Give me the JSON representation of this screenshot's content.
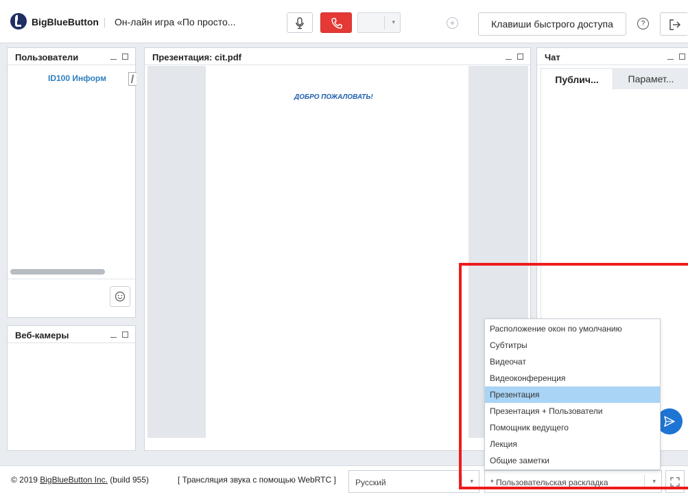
{
  "header": {
    "brand": "BigBlueButton",
    "meeting_title": "Он-лайн игра «По просто...",
    "shortcuts_label": "Клавиши быстрого доступа",
    "help_label": "?"
  },
  "users_panel": {
    "title": "Пользователи",
    "users": [
      "ID100 Информ"
    ]
  },
  "webcam_panel": {
    "title": "Веб-камеры"
  },
  "presentation_panel": {
    "title": "Презентация: cit.pdf",
    "slide_text": "ДОБРО ПОЖАЛОВАТЬ!"
  },
  "chat_panel": {
    "title": "Чат",
    "tabs": [
      {
        "label": "Публич...",
        "active": true
      },
      {
        "label": "Парамет...",
        "active": false
      }
    ]
  },
  "footer": {
    "copyright_prefix": "© 2019 ",
    "copyright_link": "BigBlueButton Inc.",
    "copyright_suffix": " (build 955)",
    "webrtc": "[ Трансляция звука с помощью WebRTC ]",
    "language": "Русский",
    "layout_current": "* Пользовательская раскладка"
  },
  "layout_menu": {
    "items": [
      "Расположение окон по умолчанию",
      "Субтитры",
      "Видеочат",
      "Видеоконференция",
      "Презентация",
      "Презентация + Пользователи",
      "Помощник ведущего",
      "Лекция",
      "Общие заметки"
    ],
    "selected": "Презентация"
  },
  "colors": {
    "accent": "#1e74d2",
    "hangup": "#e53935",
    "selection": "#a9d4f5",
    "highlight": "#ee1b1b",
    "user_name": "#2d7fc1"
  }
}
